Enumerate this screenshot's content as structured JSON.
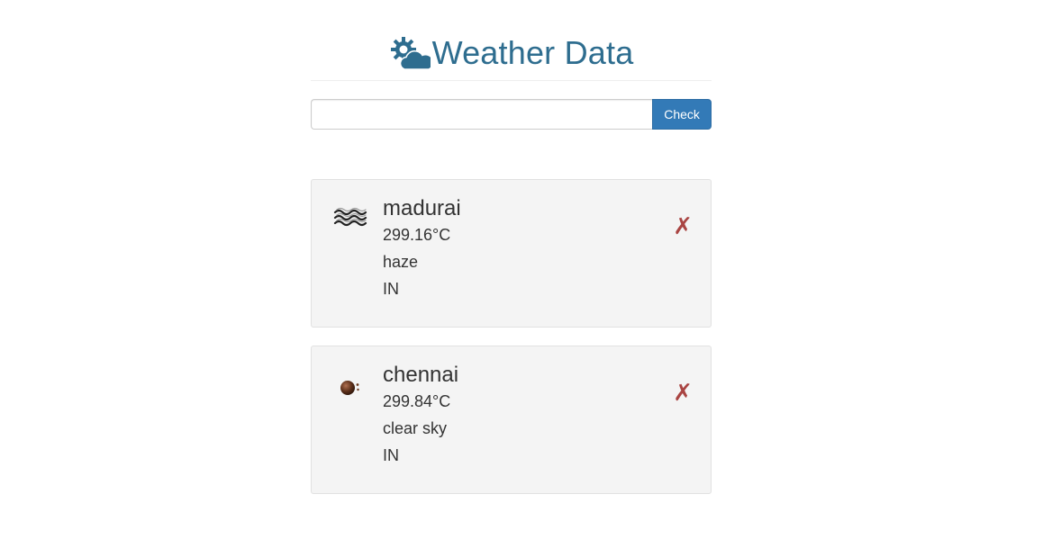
{
  "header": {
    "title": "Weather Data",
    "logo_icon": "sun-cloud-icon",
    "title_color": "#2e6d8f"
  },
  "search": {
    "value": "",
    "placeholder": "",
    "button_label": "Check",
    "button_color": "#337ab7"
  },
  "cards": [
    {
      "city": "madurai",
      "temperature": "299.16°C",
      "description": "haze",
      "country": "IN",
      "icon": "haze-icon",
      "remove_label": "✗"
    },
    {
      "city": "chennai",
      "temperature": "299.84°C",
      "description": "clear sky",
      "country": "IN",
      "icon": "clear-sky-icon",
      "remove_label": "✗"
    }
  ],
  "colors": {
    "remove": "#a94442",
    "card_background": "#f4f4f4"
  }
}
